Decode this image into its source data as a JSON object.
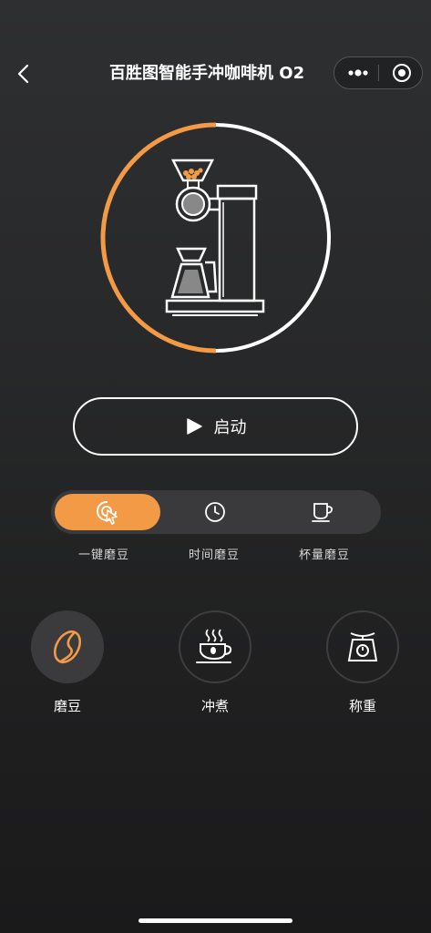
{
  "header": {
    "title": "百胜图智能手冲咖啡机 O2"
  },
  "status": {
    "progress": 0.5,
    "progress_color": "#f29a45",
    "track_color": "#ffffff"
  },
  "start_button": {
    "label": "启动"
  },
  "modes": [
    {
      "label": "一键磨豆",
      "icon": "tap-icon",
      "active": true
    },
    {
      "label": "时间磨豆",
      "icon": "clock-icon",
      "active": false
    },
    {
      "label": "杯量磨豆",
      "icon": "cup-icon",
      "active": false
    }
  ],
  "functions": [
    {
      "label": "磨豆",
      "icon": "coffee-bean-icon"
    },
    {
      "label": "冲煮",
      "icon": "hot-coffee-cup-icon"
    },
    {
      "label": "称重",
      "icon": "scale-icon"
    }
  ],
  "colors": {
    "accent": "#f29a45",
    "segment_bg": "#3a3a3c"
  }
}
